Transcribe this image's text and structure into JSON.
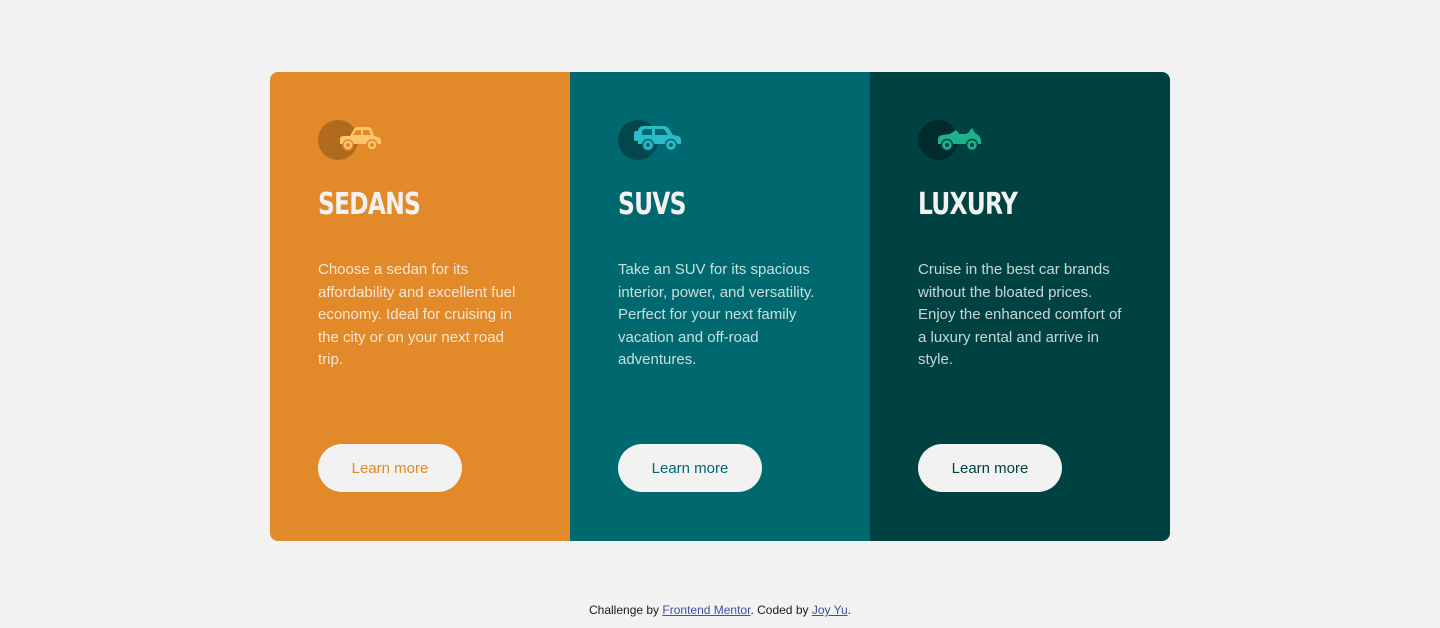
{
  "cards": [
    {
      "title": "Sedans",
      "text": "Choose a sedan for its affordability and excellent fuel economy. Ideal for cruising in the city or on your next road trip.",
      "button_label": "Learn more",
      "icon": "sedan-car-icon",
      "color": "#e28929"
    },
    {
      "title": "SUVs",
      "text": "Take an SUV for its spacious interior, power, and versatility. Perfect for your next family vacation and off-road adventures.",
      "button_label": "Learn more",
      "icon": "suv-car-icon",
      "color": "#006970"
    },
    {
      "title": "Luxury",
      "text": "Cruise in the best car brands without the bloated prices. Enjoy the enhanced comfort of a luxury rental and arrive in style.",
      "button_label": "Learn more",
      "icon": "luxury-car-icon",
      "color": "#004241"
    }
  ],
  "footer": {
    "prefix": "Challenge by ",
    "link1": "Frontend Mentor",
    "middle": ". Coded by ",
    "link2": "Joy Yu",
    "suffix": "."
  },
  "colors": {
    "background": "#f2f2f2",
    "sedans": "#e28929",
    "suvs": "#006970",
    "luxury": "#004241",
    "sedan_icon": "#ffc66d",
    "suv_icon": "#2dbbc7",
    "luxury_icon": "#1eb28b"
  }
}
